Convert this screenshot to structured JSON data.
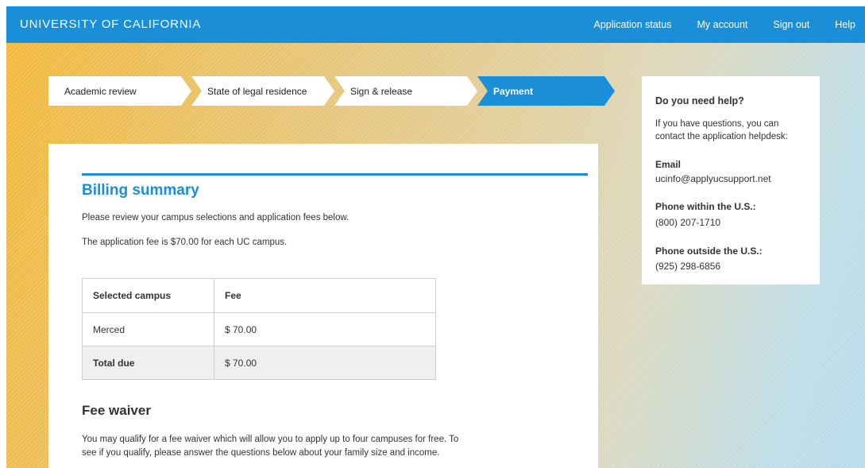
{
  "header": {
    "brand": "UNIVERSITY OF CALIFORNIA",
    "nav": [
      "Application status",
      "My account",
      "Sign out",
      "Help"
    ]
  },
  "steps": [
    {
      "label": "Academic review",
      "active": false
    },
    {
      "label": "State of legal residence",
      "active": false
    },
    {
      "label": "Sign & release",
      "active": false
    },
    {
      "label": "Payment",
      "active": true
    }
  ],
  "billing": {
    "title": "Billing summary",
    "intro": "Please review your campus selections and application fees below.",
    "fee_note": "The application fee is $70.00 for each UC campus.",
    "table": {
      "headers": [
        "Selected campus",
        "Fee"
      ],
      "rows": [
        [
          "Merced",
          "$ 70.00"
        ]
      ],
      "total": [
        "Total due",
        "$ 70.00"
      ]
    }
  },
  "fee_waiver": {
    "title": "Fee waiver",
    "text": "You may qualify for a fee waiver which will allow you to apply up to four campuses for free. To see if you qualify, please answer the questions below about your family size and income."
  },
  "help": {
    "title": "Do you need help?",
    "intro": "If you have questions, you can contact the application helpdesk:",
    "email_label": "Email",
    "email": "ucinfo@applyucsupport.net",
    "phone_us_label": "Phone within the U.S.:",
    "phone_us": "(800) 207-1710",
    "phone_intl_label": "Phone outside the U.S.:",
    "phone_intl": "(925) 298-6856"
  },
  "colors": {
    "brand_blue": "#1a8fd8",
    "total_row_bg": "#efefef"
  }
}
